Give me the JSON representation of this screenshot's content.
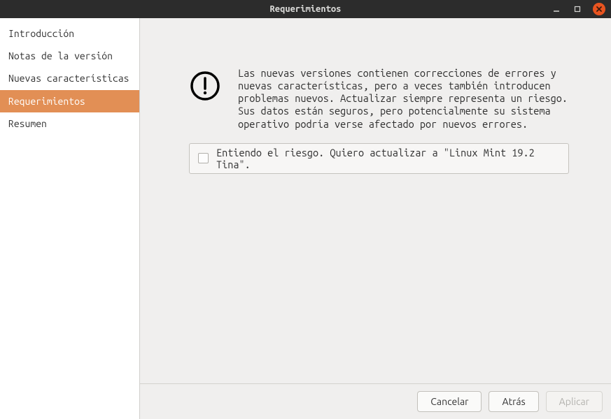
{
  "window": {
    "title": "Requerimientos"
  },
  "sidebar": {
    "items": [
      {
        "label": "Introducción",
        "active": false
      },
      {
        "label": "Notas de la versión",
        "active": false
      },
      {
        "label": "Nuevas características",
        "active": false
      },
      {
        "label": "Requerimientos",
        "active": true
      },
      {
        "label": "Resumen",
        "active": false
      }
    ]
  },
  "content": {
    "warning_text": "Las nuevas versiones contienen correcciones de errores y nuevas características, pero a veces también introducen problemas nuevos. Actualizar siempre representa un riesgo. Sus datos están seguros, pero potencialmente su sistema operativo podría verse afectado por nuevos errores.",
    "checkbox_label": "Entiendo el riesgo. Quiero actualizar a \"Linux Mint 19.2 Tina\".",
    "checkbox_checked": false
  },
  "footer": {
    "cancel_label": "Cancelar",
    "back_label": "Atrás",
    "apply_label": "Aplicar",
    "apply_enabled": false
  }
}
